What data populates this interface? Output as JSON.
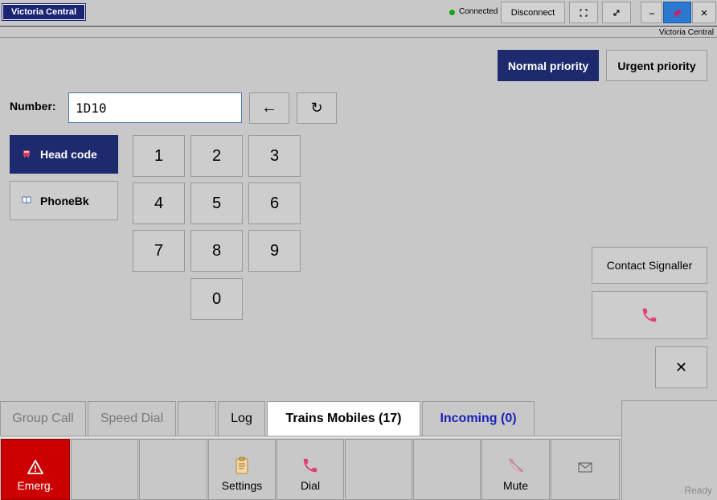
{
  "window": {
    "app_name": "Victoria Central",
    "status": "Connected",
    "disconnect_label": "Disconnect",
    "subtitle": "Victoria Central"
  },
  "priority": {
    "normal_label": "Normal priority",
    "urgent_label": "Urgent priority"
  },
  "dialer": {
    "number_label": "Number:",
    "number_value": "1D10",
    "backspace_glyph": "←",
    "refresh_glyph": "↻",
    "headcode_label": "Head code",
    "phonebk_label": "PhoneBk",
    "keys": [
      "1",
      "2",
      "3",
      "4",
      "5",
      "6",
      "7",
      "8",
      "9",
      "0"
    ]
  },
  "right_panel": {
    "contact_signaller_label": "Contact Signaller",
    "clear_glyph": "✕"
  },
  "tabs": {
    "group_call": "Group Call",
    "speed_dial": "Speed Dial",
    "log": "Log",
    "trains_mobiles": "Trains Mobiles (17)",
    "incoming": "Incoming (0)"
  },
  "toolbar": {
    "emergency_label": "Emerg.",
    "settings_label": "Settings",
    "dial_label": "Dial",
    "mute_label": "Mute"
  },
  "status_bar": {
    "ready": "Ready"
  },
  "colors": {
    "accent_navy": "#1e2a6e",
    "emergency_red": "#cc0000",
    "incoming_blue": "#1a22b8",
    "connected_green": "#18a018",
    "phone_pink": "#e0407a"
  }
}
